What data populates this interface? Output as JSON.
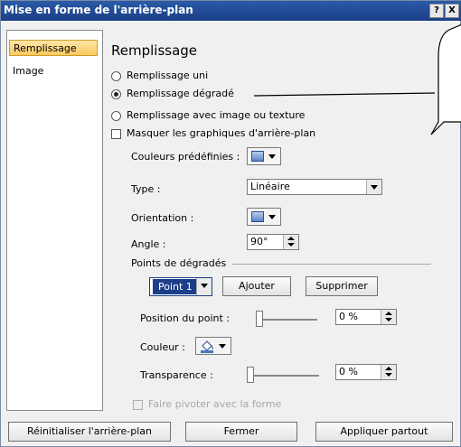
{
  "window": {
    "title": "Mise en forme de l'arrière-plan",
    "help_label": "?",
    "close_label": "X"
  },
  "nav": {
    "items": [
      {
        "label": "Remplissage"
      },
      {
        "label": "Image"
      }
    ]
  },
  "content": {
    "heading": "Remplissage",
    "fill_options": {
      "solid": "Remplissage uni",
      "gradient": "Remplissage dégradé",
      "picture": "Remplissage avec image ou texture",
      "hide_graphics": "Masquer les graphiques d'arrière-plan"
    },
    "preset_colors_label": "Couleurs prédéfinies :",
    "type_label": "Type :",
    "type_value": "Linéaire",
    "orientation_label": "Orientation :",
    "angle_label": "Angle :",
    "angle_value": "90°",
    "stops_section_label": "Points de dégradés",
    "stop_selected": "Point 1",
    "add_button": "Ajouter",
    "remove_button": "Supprimer",
    "stop_position_label": "Position du point :",
    "stop_position_value": "0 %",
    "color_label": "Couleur :",
    "transparency_label": "Transparence :",
    "transparency_value": "0 %",
    "rotate_with_shape": "Faire pivoter avec la forme"
  },
  "footer": {
    "reset_button": "Réinitialiser l'arrière-plan",
    "close_button": "Fermer",
    "apply_all_button": "Appliquer partout"
  },
  "colors": {
    "titlebar": "#1f4a95",
    "nav_selected": "#f8c860",
    "swatch": "#5a82c6"
  }
}
